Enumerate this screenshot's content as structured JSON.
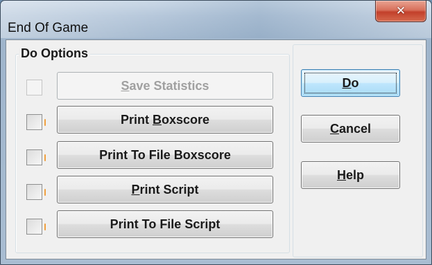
{
  "window": {
    "title": "End Of Game",
    "close_glyph": "✕"
  },
  "group": {
    "label": "Do Options"
  },
  "options": [
    {
      "pre": "",
      "mnemonic": "S",
      "post": "ave Statistics",
      "enabled": false,
      "checked": false
    },
    {
      "pre": "Print ",
      "mnemonic": "B",
      "post": "oxscore",
      "enabled": true,
      "checked": false
    },
    {
      "pre": "Print To File Boxscore",
      "mnemonic": "",
      "post": "",
      "enabled": true,
      "checked": false
    },
    {
      "pre": "",
      "mnemonic": "P",
      "post": "rint Script",
      "enabled": true,
      "checked": false
    },
    {
      "pre": "Print To File Script",
      "mnemonic": "",
      "post": "",
      "enabled": true,
      "checked": false
    }
  ],
  "actions": {
    "do": {
      "pre": "",
      "mnemonic": "D",
      "post": "o"
    },
    "cancel": {
      "pre": "",
      "mnemonic": "C",
      "post": "ancel"
    },
    "help": {
      "pre": "",
      "mnemonic": "H",
      "post": "elp"
    }
  },
  "colors": {
    "accent_default_button": "#3c7fb1",
    "close_button": "#c2402b",
    "dialog_face": "#f0f0f0"
  },
  "icons": {
    "close": "close-icon"
  }
}
